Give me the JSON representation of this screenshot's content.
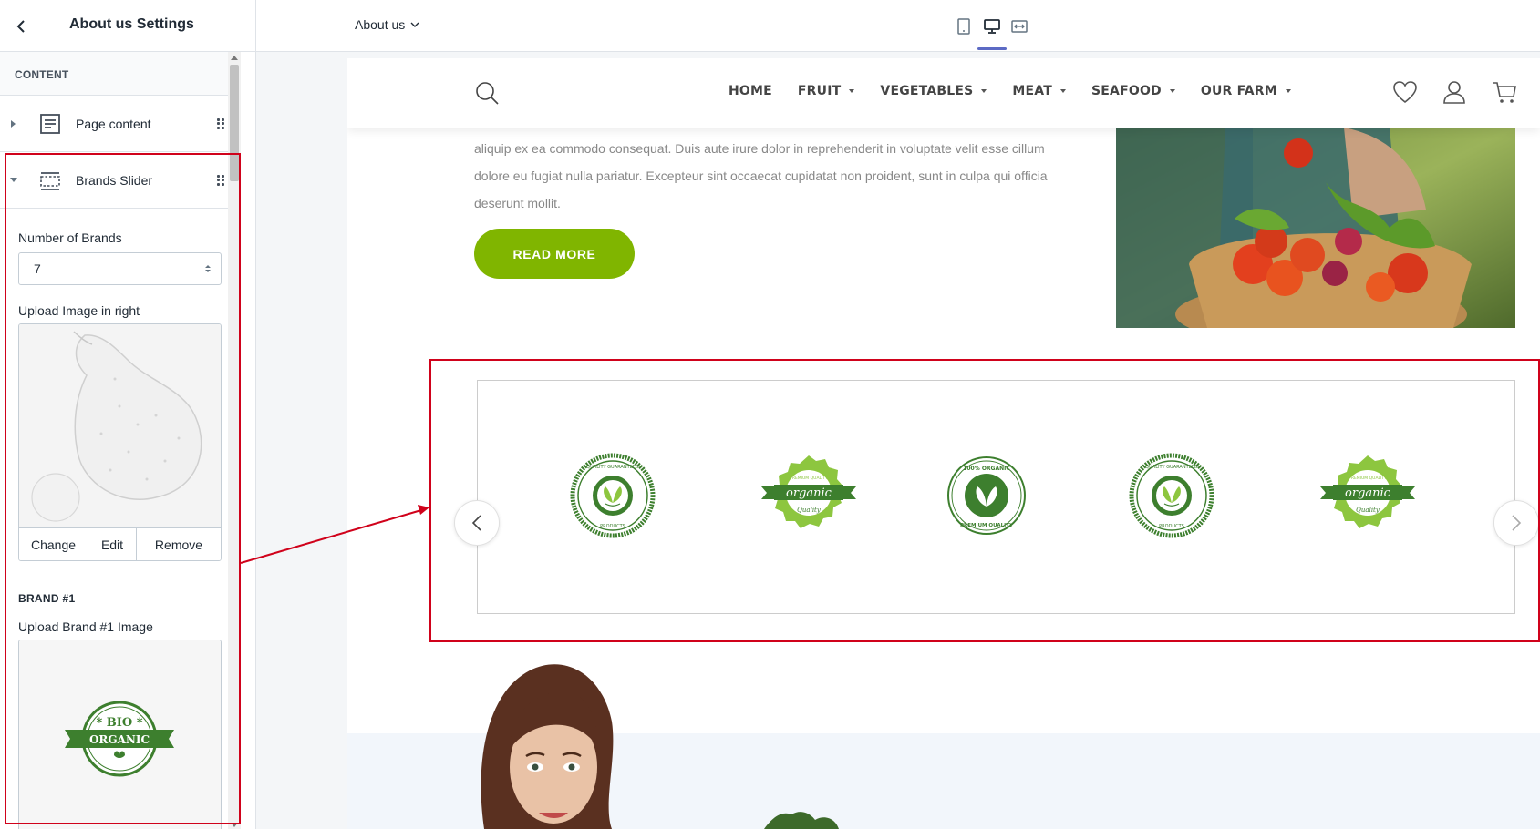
{
  "sidebar": {
    "title": "About us Settings",
    "content_label": "CONTENT",
    "sections": [
      {
        "label": "Page content"
      },
      {
        "label": "Brands Slider"
      }
    ],
    "number_of_brands_label": "Number of Brands",
    "number_of_brands_value": "7",
    "upload_right_label": "Upload Image in right",
    "image_actions": {
      "change": "Change",
      "edit": "Edit",
      "remove": "Remove"
    },
    "brand1_heading": "BRAND #1",
    "brand1_upload_label": "Upload Brand #1 Image",
    "brand1_logo": {
      "line1": "* BIO *",
      "line2": "ORGANIC"
    }
  },
  "topbar": {
    "page_dropdown": "About us",
    "viewports": [
      "mobile",
      "desktop",
      "full-width"
    ],
    "active_viewport": "desktop"
  },
  "preview": {
    "nav": [
      "HOME",
      "FRUIT",
      "VEGETABLES",
      "MEAT",
      "SEAFOOD",
      "OUR FARM"
    ],
    "nav_has_dropdown": [
      false,
      true,
      true,
      true,
      true,
      true
    ],
    "about_text": "aliquip ex ea commodo consequat. Duis aute irure dolor in reprehenderit in voluptate velit esse cillum dolore eu fugiat nulla pariatur. Excepteur sint occaecat cupidatat non proident, sunt in culpa qui officia deserunt mollit.",
    "read_more": "READ MORE",
    "brand_logos": [
      {
        "type": "quality-guaranteed",
        "top": "QUALITY GUARANTEED",
        "bottom": "PRODUCTS"
      },
      {
        "type": "organic-quality",
        "ribbon": "organic",
        "top": "PREMIUM QUALITY",
        "bottom": "Quality"
      },
      {
        "type": "premium-quality",
        "top": "100% ORGANIC",
        "bottom": "PREMIUM QUALITY"
      },
      {
        "type": "quality-guaranteed",
        "top": "QUALITY GUARANTEED",
        "bottom": "PRODUCTS"
      },
      {
        "type": "organic-quality",
        "ribbon": "organic",
        "top": "PREMIUM QUALITY",
        "bottom": "Quality"
      }
    ]
  },
  "colors": {
    "accent": "#80b500",
    "highlight": "#d0021b",
    "brand_green_dark": "#3d7f2e",
    "brand_green_light": "#8dc63f",
    "active_tab": "#5c6ac4"
  }
}
